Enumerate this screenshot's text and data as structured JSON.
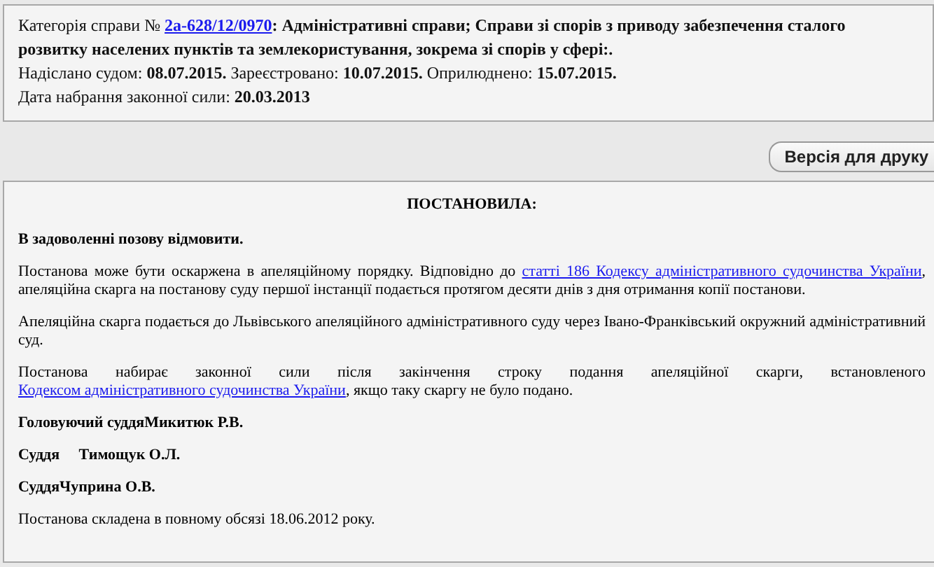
{
  "info": [
    {
      "before": "Категорія справи № ",
      "link": "2а-628/12/0970",
      "after": "**: Адміністративні справи; Справи зі спорів з приводу забезпечення сталого розвитку населених пунктів та землекористування, зокрема зі спорів у сфері:.**"
    },
    {
      "before": "Надіслано судом: **08.07.2015.** Зареєстровано: **10.07.2015.** Оприлюднено: **15.07.2015.**"
    },
    {
      "before": "Дата набрання законної сили: **20.03.2013**"
    }
  ],
  "print_button": "Версія для друку",
  "document": [
    {
      "kind": "heading",
      "before": "ПОСТАНОВИЛА:"
    },
    {
      "kind": "bold",
      "before": "В задоволенні позову відмовити."
    },
    {
      "kind": "text",
      "before": "Постанова може бути оскаржена в апеляційному порядку. Відповідно до ",
      "link": "статті 186 Кодексу адміністративного судочинства України",
      "after": ", апеляційна скарга на постанову суду першої інстанції подається протягом десяти днів з дня отримання копії постанови."
    },
    {
      "kind": "text",
      "before": "Апеляційна скарга подається до Львівського апеляційного адміністративного суду через Івано-Франківський окружний адміністративний суд."
    },
    {
      "kind": "text",
      "before": "Постанова набирає законної сили після закінчення строку подання апеляційної скарги, встановленого ",
      "link": "Кодексом адміністративного судочинства України",
      "after": ", якщо таку скаргу не було подано."
    },
    {
      "kind": "bold",
      "before": "Головуючий суддяМикитюк Р.В."
    },
    {
      "kind": "bold",
      "before": "Суддя     Тимощук О.Л."
    },
    {
      "kind": "bold",
      "before": "СуддяЧуприна О.В."
    },
    {
      "kind": "text",
      "before": "Постанова складена в повному обсязі 18.06.2012 року."
    }
  ]
}
